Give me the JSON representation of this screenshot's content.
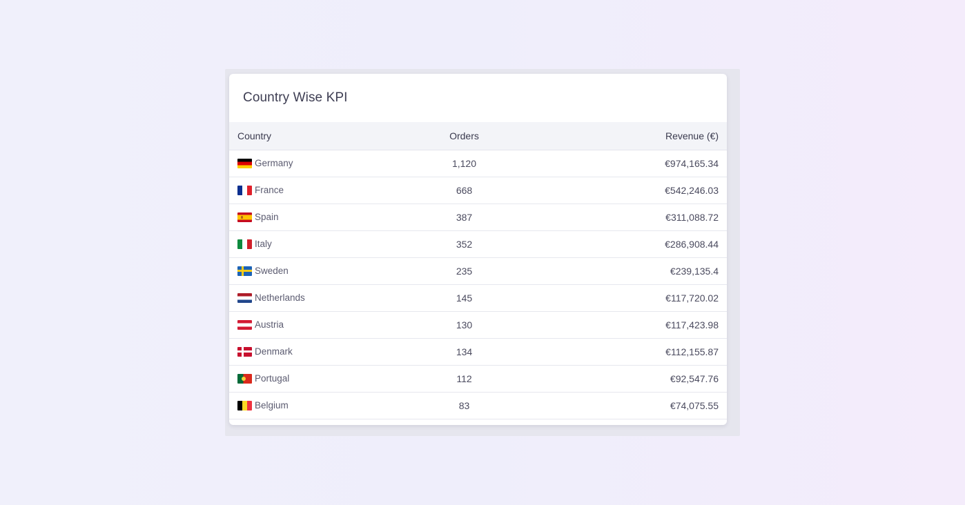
{
  "card": {
    "title": "Country Wise KPI"
  },
  "table": {
    "headers": {
      "country": "Country",
      "orders": "Orders",
      "revenue": "Revenue (€)"
    },
    "rows": [
      {
        "country": "Germany",
        "flag": "flag-de",
        "orders": "1,120",
        "revenue": "€974,165.34"
      },
      {
        "country": "France",
        "flag": "flag-fr",
        "orders": "668",
        "revenue": "€542,246.03"
      },
      {
        "country": "Spain",
        "flag": "flag-es",
        "orders": "387",
        "revenue": "€311,088.72"
      },
      {
        "country": "Italy",
        "flag": "flag-it",
        "orders": "352",
        "revenue": "€286,908.44"
      },
      {
        "country": "Sweden",
        "flag": "flag-se",
        "orders": "235",
        "revenue": "€239,135.4"
      },
      {
        "country": "Netherlands",
        "flag": "flag-nl",
        "orders": "145",
        "revenue": "€117,720.02"
      },
      {
        "country": "Austria",
        "flag": "flag-at",
        "orders": "130",
        "revenue": "€117,423.98"
      },
      {
        "country": "Denmark",
        "flag": "flag-dk",
        "orders": "134",
        "revenue": "€112,155.87"
      },
      {
        "country": "Portugal",
        "flag": "flag-pt",
        "orders": "112",
        "revenue": "€92,547.76"
      },
      {
        "country": "Belgium",
        "flag": "flag-be",
        "orders": "83",
        "revenue": "€74,075.55"
      }
    ]
  },
  "colors": {
    "background": "#f0f0fb",
    "card": "#ffffff",
    "header_row": "#f3f4f8",
    "text": "#3a3a4e"
  }
}
